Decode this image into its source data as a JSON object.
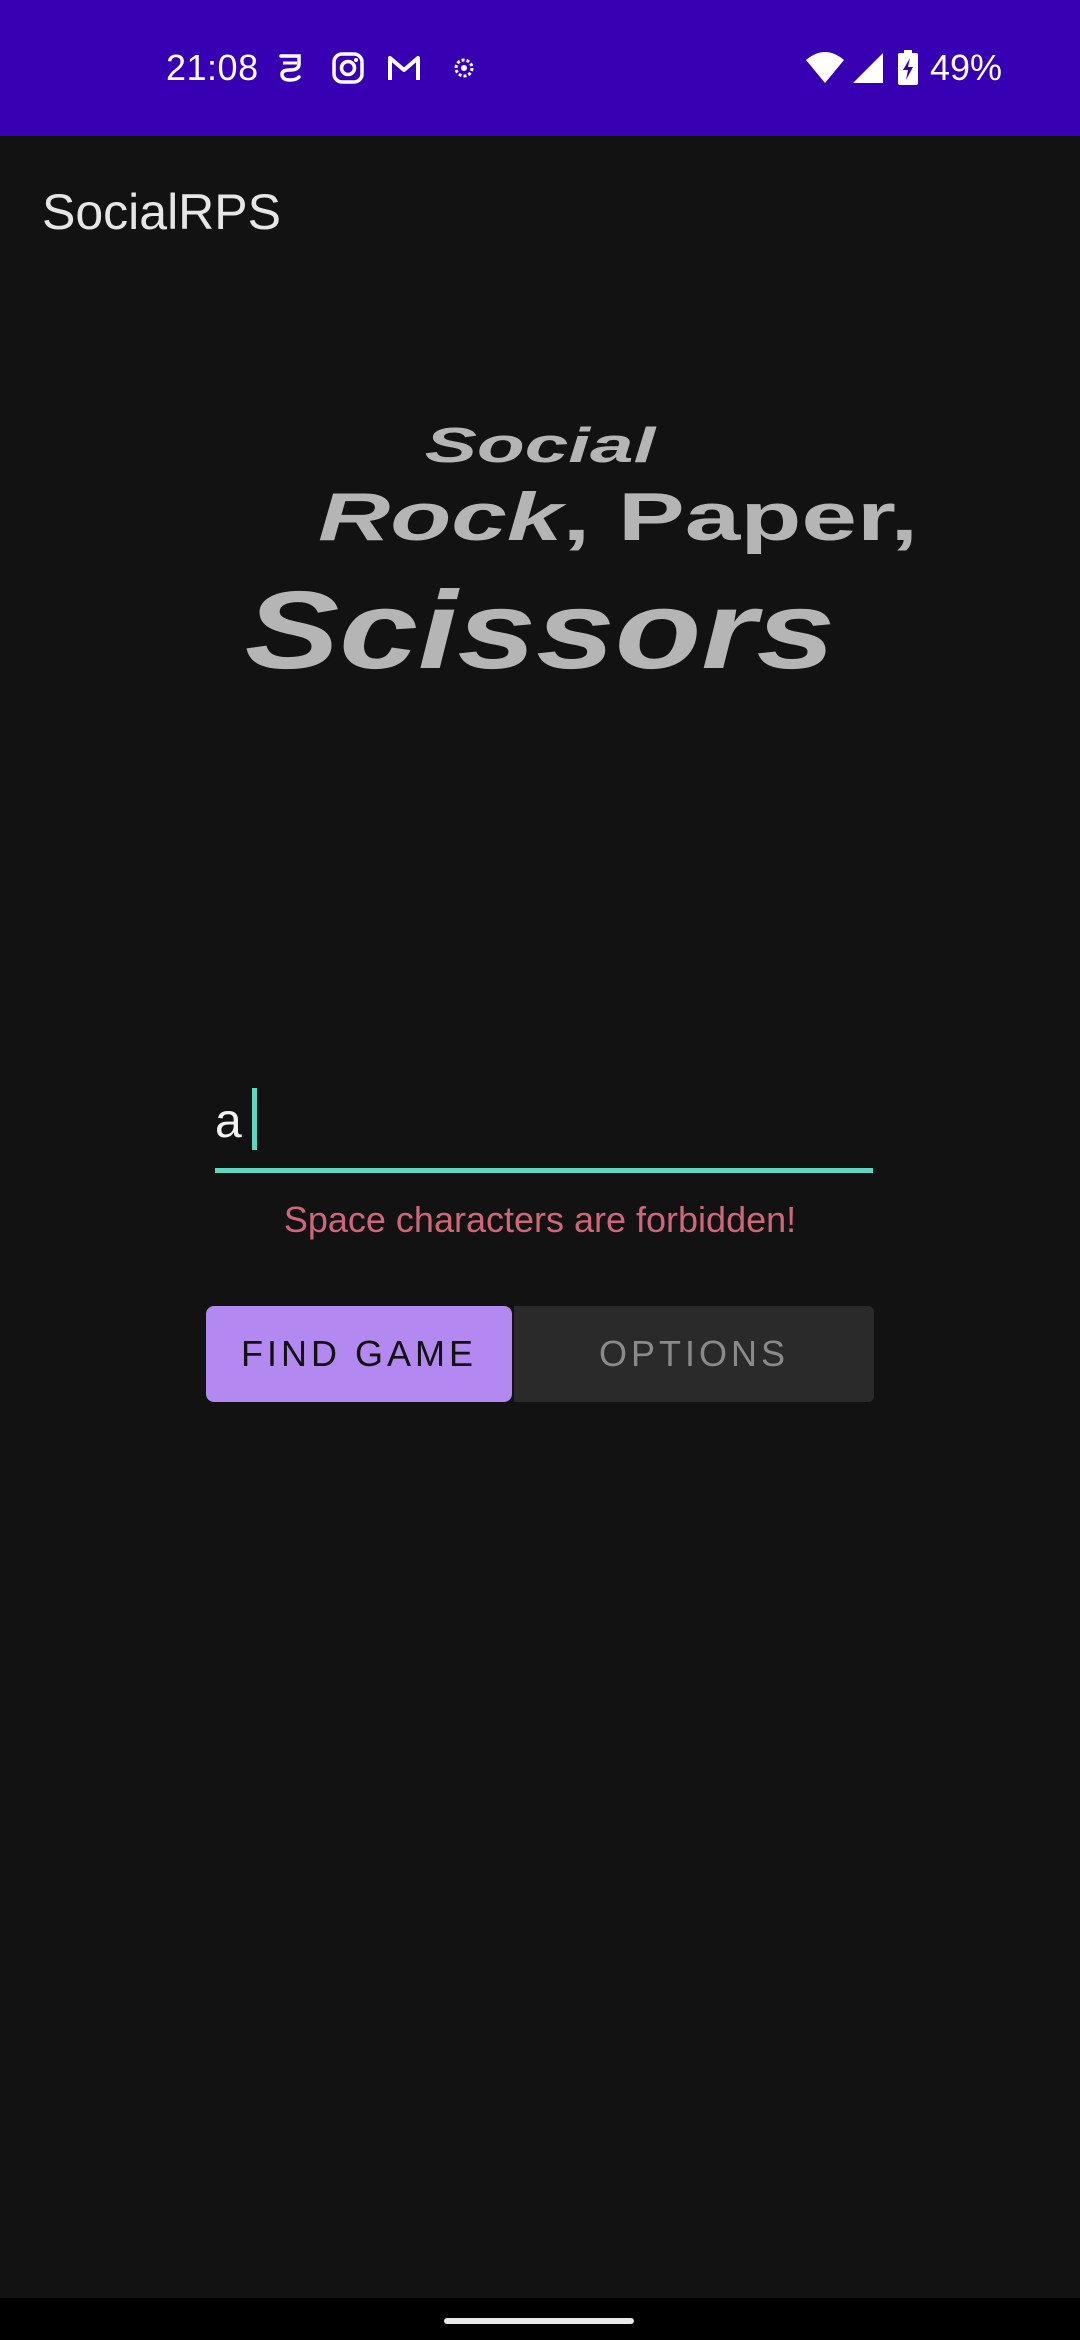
{
  "status_bar": {
    "time": "21:08",
    "battery": "49%",
    "notification_icons": [
      "mask-icon",
      "instagram-icon",
      "gmail-icon",
      "ring-icon"
    ],
    "system_icons": [
      "wifi-icon",
      "signal-icon",
      "battery-charging-icon"
    ],
    "background_color": "#3700b3"
  },
  "app_bar": {
    "title": "SocialRPS"
  },
  "logo": {
    "line1": "Social",
    "line2_a": "Rock",
    "line2_b": ", Paper,",
    "line3": "Scissors",
    "color": "#b5b5b5"
  },
  "form": {
    "username_value": "a",
    "error_message": "Space characters are forbidden!",
    "accent_color": "#5fd6c0",
    "error_color": "#cf6679"
  },
  "buttons": {
    "find_game": "FIND GAME",
    "options": "OPTIONS",
    "primary_color": "#b388f0"
  }
}
